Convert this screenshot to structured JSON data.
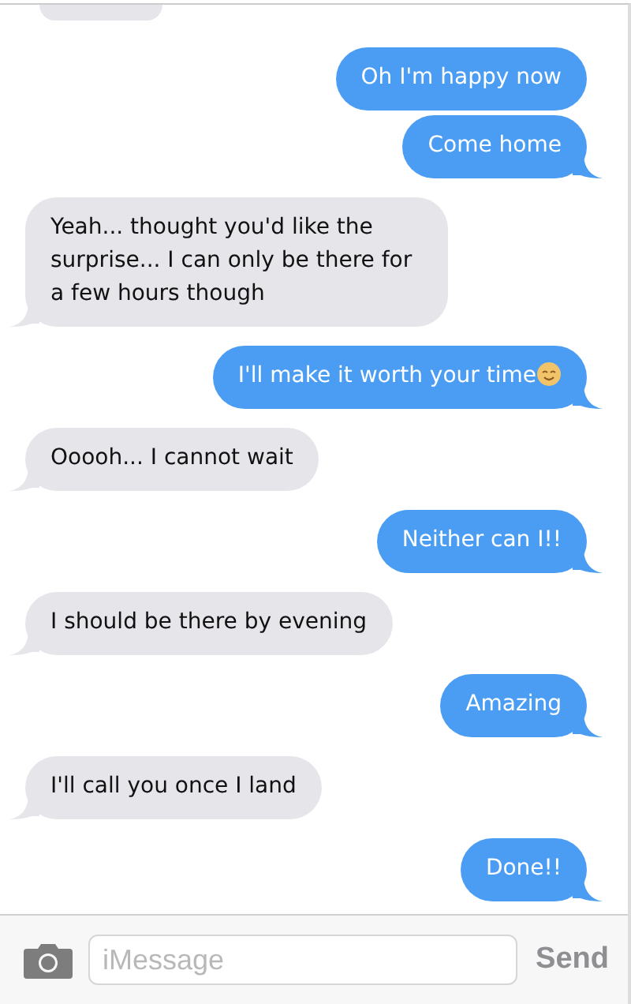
{
  "messages": [
    {
      "kind": "partial"
    },
    {
      "kind": "sent",
      "text": "Oh I'm happy now"
    },
    {
      "kind": "sent",
      "text": "Come home"
    },
    {
      "kind": "received",
      "text": "Yeah... thought you'd like the surprise... I can only be there for a few hours though"
    },
    {
      "kind": "sent",
      "text": "I'll make it worth your time",
      "emoji": true
    },
    {
      "kind": "received",
      "text": "Ooooh... I cannot wait"
    },
    {
      "kind": "sent",
      "text": "Neither can I!!"
    },
    {
      "kind": "received",
      "text": "I should be there by evening"
    },
    {
      "kind": "sent",
      "text": "Amazing"
    },
    {
      "kind": "received",
      "text": "I'll call you once I land"
    },
    {
      "kind": "sent",
      "text": "Done!!"
    }
  ],
  "composer": {
    "placeholder": "iMessage",
    "send": "Send"
  }
}
